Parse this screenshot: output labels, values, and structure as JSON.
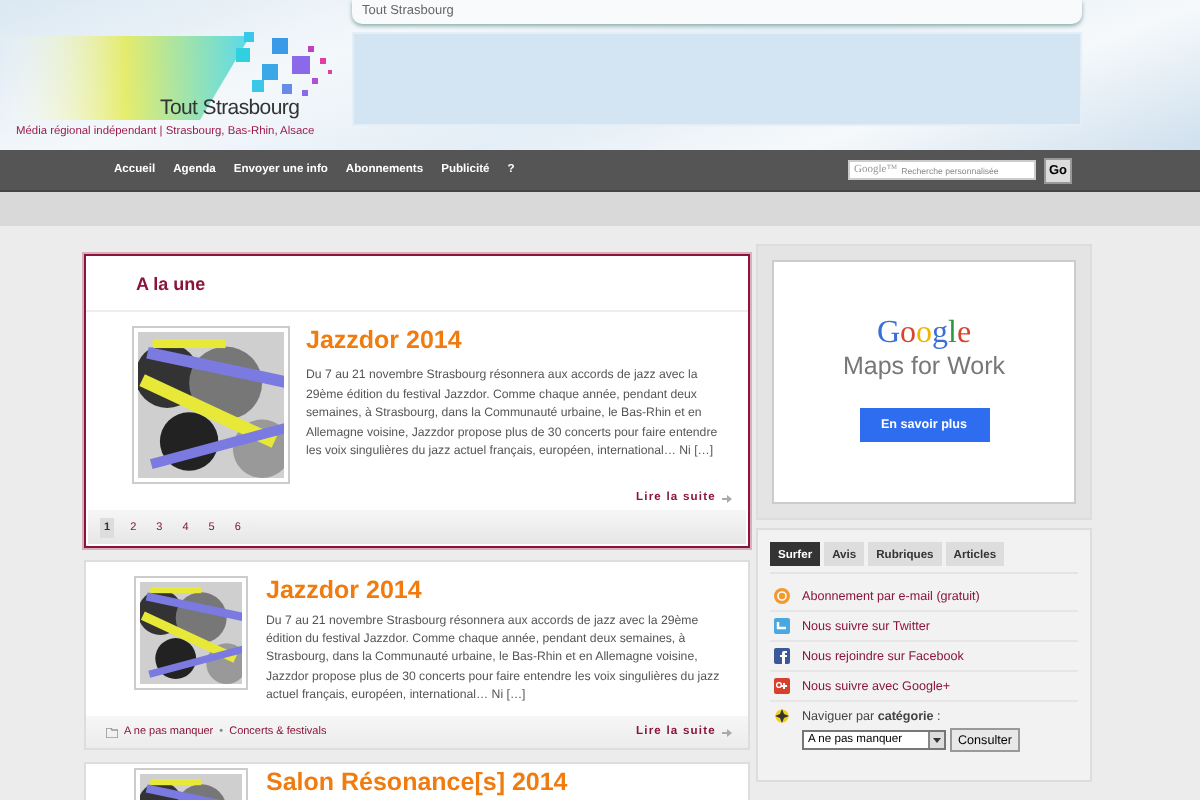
{
  "header": {
    "top_bar": "Tout Strasbourg",
    "site_name": "Tout Strasbourg",
    "tagline": "Média régional indépendant | Strasbourg, Bas-Rhin, Alsace"
  },
  "nav": {
    "items": [
      "Accueil",
      "Agenda",
      "Envoyer une info",
      "Abonnements",
      "Publicité",
      "?"
    ],
    "search": {
      "brand": "Google™",
      "placeholder": "Recherche personnalisée",
      "button": "Go"
    }
  },
  "featured": {
    "heading": "A la une",
    "post": {
      "title": "Jazzdor 2014",
      "excerpt": "Du 7 au 21 novembre Strasbourg résonnera aux accords de jazz avec la 29ème édition du festival Jazzdor. Comme chaque année, pendant deux semaines, à Strasbourg, dans la Communauté urbaine, le Bas-Rhin et en Allemagne voisine, Jazzdor propose plus de 30 concerts pour faire entendre les voix singulières du jazz actuel français, européen, international… Ni […]",
      "more": "Lire la suite"
    },
    "pages": [
      {
        "label": "1",
        "selected": true
      },
      {
        "label": "2",
        "selected": false
      },
      {
        "label": "3",
        "selected": false
      },
      {
        "label": "4",
        "selected": false
      },
      {
        "label": "5",
        "selected": false
      },
      {
        "label": "6",
        "selected": false
      }
    ]
  },
  "posts": [
    {
      "title": "Jazzdor 2014",
      "excerpt": "Du 7 au 21 novembre Strasbourg résonnera aux accords de jazz avec la 29ème édition du festival Jazzdor. Comme chaque année, pendant deux semaines, à Strasbourg, dans la Communauté urbaine, le Bas-Rhin et en Allemagne voisine, Jazzdor propose plus de 30 concerts pour faire entendre les voix singulières du jazz actuel français, européen, international… Ni […]",
      "categories": [
        "A ne pas manquer",
        "Concerts & festivals"
      ],
      "category_separator": "•",
      "more": "Lire la suite"
    },
    {
      "title": "Salon Résonance[s] 2014"
    }
  ],
  "ad": {
    "brand": "Google",
    "product": "Maps for Work",
    "button": "En savoir plus"
  },
  "widget": {
    "tabs": [
      {
        "label": "Surfer",
        "selected": true
      },
      {
        "label": "Avis",
        "selected": false
      },
      {
        "label": "Rubriques",
        "selected": false
      },
      {
        "label": "Articles",
        "selected": false
      }
    ],
    "links": [
      {
        "kind": "email",
        "text": "Abonnement par e-mail (gratuit)"
      },
      {
        "kind": "twitter",
        "text": "Nous suivre sur Twitter"
      },
      {
        "kind": "facebook",
        "text": "Nous rejoindre sur Facebook"
      },
      {
        "kind": "googleplus",
        "text": "Nous suivre avec Google+"
      }
    ],
    "navigate": {
      "label": "Naviguer par **catégorie** :",
      "select": "A ne pas manquer",
      "button": "Consulter"
    }
  }
}
